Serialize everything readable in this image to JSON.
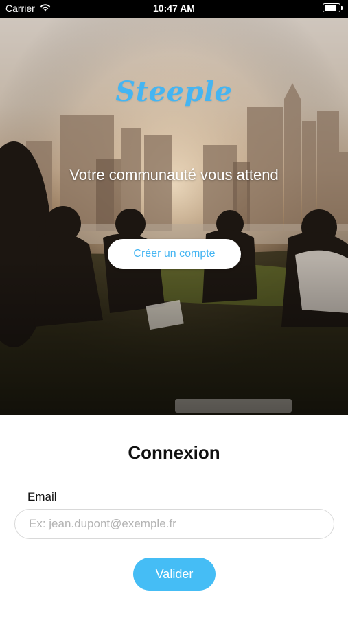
{
  "status_bar": {
    "carrier": "Carrier",
    "time": "10:47 AM",
    "wifi_icon": "wifi-icon",
    "battery_icon": "battery-icon",
    "battery_level": 0.85
  },
  "hero": {
    "brand": "Steeple",
    "tagline": "Votre communauté vous attend",
    "create_account_label": "Créer un compte",
    "background_image": "city-skyline-picnic-photo"
  },
  "login": {
    "title": "Connexion",
    "email_label": "Email",
    "email_placeholder": "Ex: jean.dupont@exemple.fr",
    "email_value": "",
    "submit_label": "Valider"
  },
  "colors": {
    "accent": "#45b5f2",
    "button_fill": "#45bdf5",
    "status_bar": "#000000"
  }
}
